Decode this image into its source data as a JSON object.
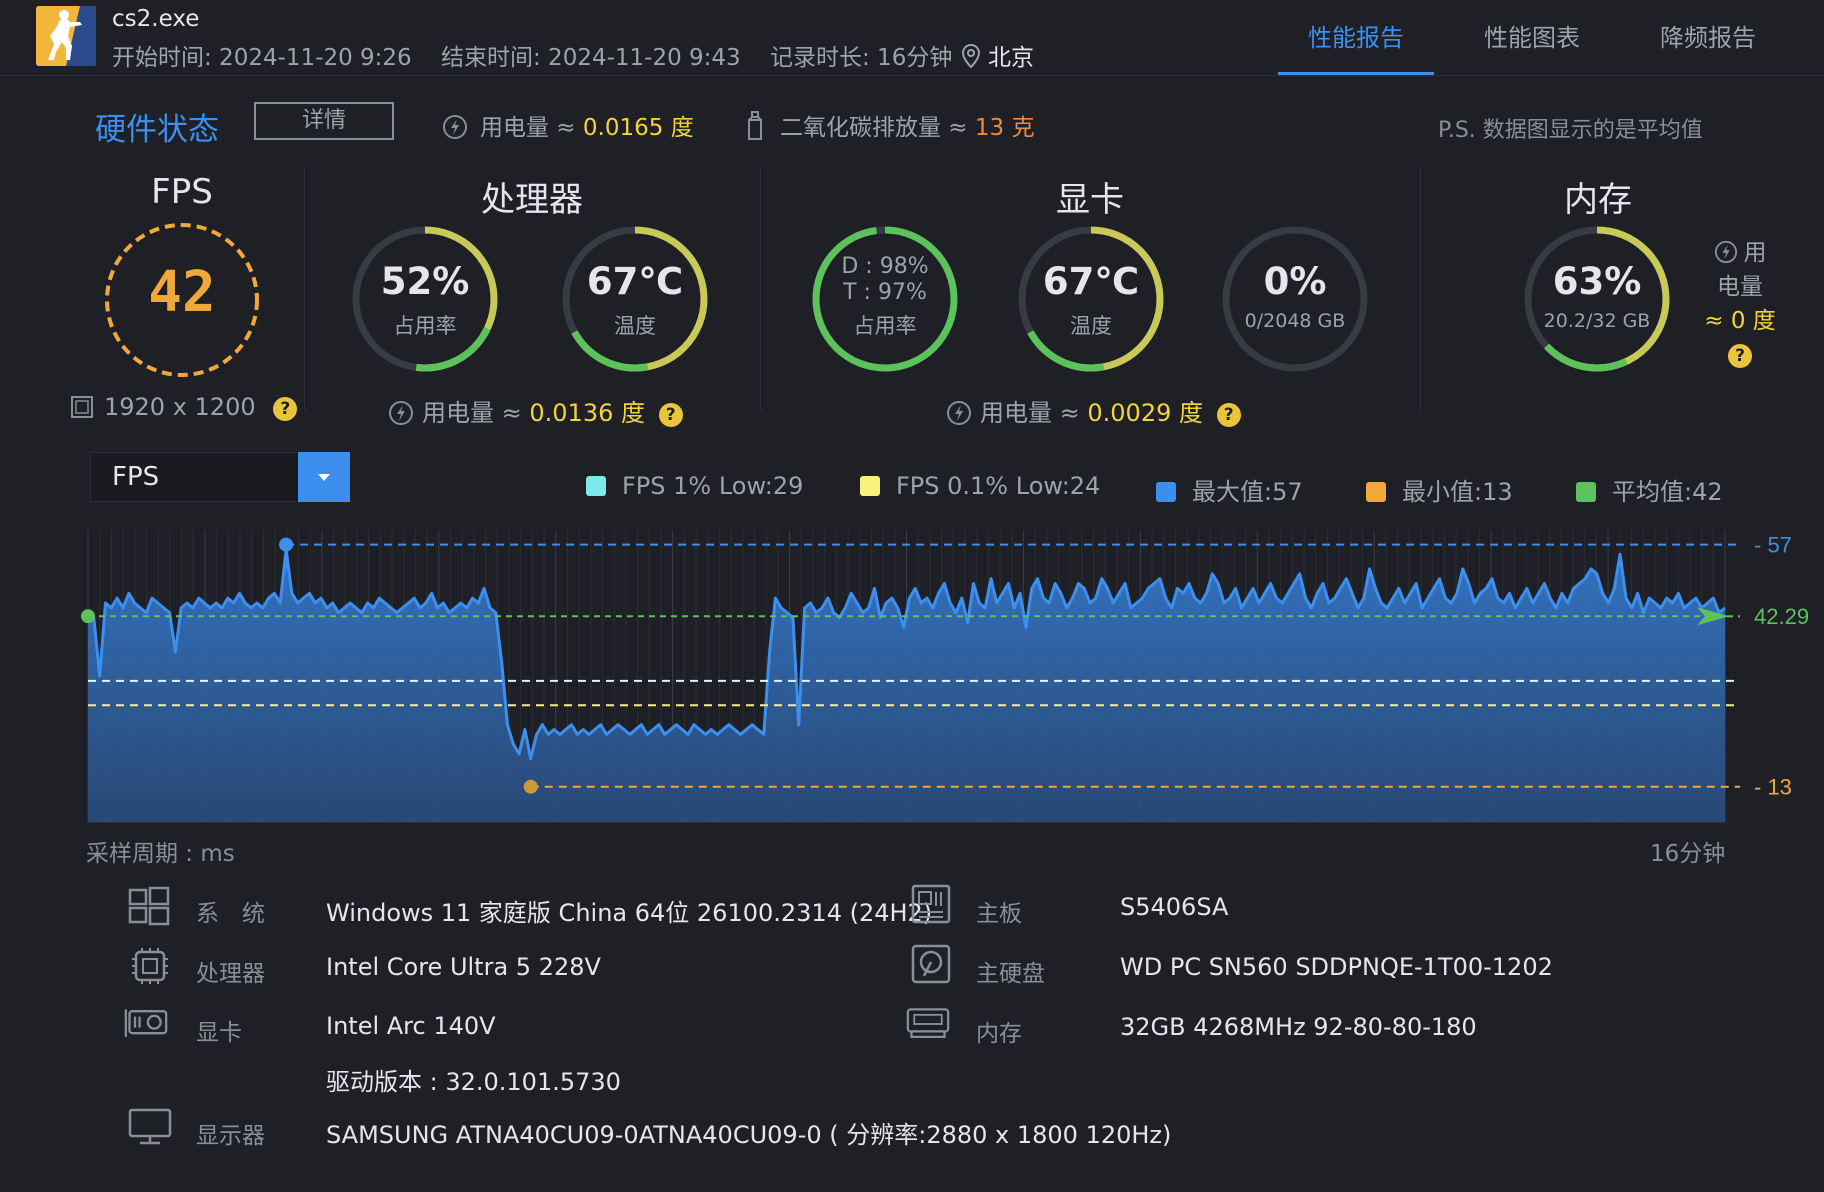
{
  "header": {
    "app_name": "cs2.exe",
    "start_time": "开始时间: 2024-11-20 9:26",
    "end_time": "结束时间: 2024-11-20 9:43",
    "duration": "记录时长: 16分钟",
    "location": "北京",
    "tabs": [
      "性能报告",
      "性能图表",
      "降频报告"
    ],
    "active_tab": "性能报告"
  },
  "hardware": {
    "title": "硬件状态",
    "details_label": "详情",
    "energy_label": "用电量 ≈ ",
    "energy_value": "0.0165 度",
    "co2_label": "二氧化碳排放量 ≈ ",
    "co2_value": "13 克",
    "note": "P.S. 数据图显示的是平均值"
  },
  "fps": {
    "title": "FPS",
    "value": "42",
    "resolution": "1920 x 1200"
  },
  "cpu": {
    "title": "处理器",
    "usage_value": "52%",
    "usage_label": "占用率",
    "usage_fraction": 0.52,
    "temp_value": "67℃",
    "temp_label": "温度",
    "temp_fraction": 0.67,
    "energy_label": "用电量 ≈ ",
    "energy_value": "0.0136 度"
  },
  "gpu": {
    "title": "显卡",
    "usage_d": "D : 98%",
    "usage_t": "T : 97%",
    "usage_label": "占用率",
    "usage_fraction": 0.98,
    "temp_value": "67℃",
    "temp_label": "温度",
    "temp_fraction": 0.67,
    "vram_value": "0%",
    "vram_label": "0/2048 GB",
    "vram_fraction": 0,
    "energy_label": "用电量 ≈ ",
    "energy_value": "0.0029 度"
  },
  "memory": {
    "title": "内存",
    "usage_value": "63%",
    "usage_label": "20.2/32 GB",
    "usage_fraction": 0.63,
    "energy_line1": "用",
    "energy_line2": "电量",
    "energy_line3": "≈ 0 度"
  },
  "chart_controls": {
    "selected_metric": "FPS",
    "legend": [
      {
        "label": "FPS 1% Low:29",
        "color": "#7ee8e8"
      },
      {
        "label": "FPS 0.1% Low:24",
        "color": "#f7f27a"
      },
      {
        "label": "最大值:57",
        "color": "#3d8fef"
      },
      {
        "label": "最小值:13",
        "color": "#f0a83a"
      },
      {
        "label": "平均值:42",
        "color": "#5cc25c"
      }
    ],
    "sample_period": "采样周期 : ms",
    "duration": "16分钟"
  },
  "chart_data": {
    "type": "area",
    "title": "",
    "xlabel": "",
    "ylabel": "",
    "ylim": [
      0,
      60
    ],
    "max": 57,
    "min": 13,
    "avg": 42.29,
    "low_1pct": 29,
    "low_01pct": 24,
    "max_label": "57",
    "avg_label": "42.29",
    "min_label": "13",
    "series": [
      {
        "values": [
          42,
          42,
          30,
          45,
          44,
          46,
          44,
          47,
          45,
          44,
          43,
          46,
          45,
          44,
          43,
          35,
          44,
          45,
          44,
          46,
          45,
          44,
          45,
          44,
          46,
          45,
          47,
          45,
          44,
          45,
          44,
          46,
          47,
          45,
          56,
          47,
          45,
          46,
          47,
          45,
          46,
          44,
          45,
          43,
          44,
          45,
          44,
          43,
          45,
          44,
          46,
          45,
          44,
          43,
          44,
          45,
          46,
          44,
          45,
          47,
          44,
          45,
          43,
          44,
          45,
          44,
          46,
          45,
          48,
          44,
          43,
          33,
          20,
          16,
          14,
          19,
          13,
          18,
          20,
          18,
          19,
          18,
          19,
          20,
          18,
          19,
          18,
          19,
          20,
          18,
          19,
          20,
          19,
          18,
          19,
          20,
          18,
          19,
          20,
          18,
          19,
          20,
          19,
          18,
          20,
          19,
          18,
          19,
          18,
          19,
          20,
          19,
          18,
          19,
          20,
          19,
          18,
          35,
          46,
          44,
          43,
          42,
          20,
          44,
          45,
          43,
          44,
          46,
          43,
          42,
          44,
          47,
          45,
          43,
          44,
          48,
          42,
          45,
          46,
          44,
          40,
          46,
          48,
          45,
          46,
          44,
          47,
          49,
          45,
          43,
          46,
          41,
          49,
          45,
          44,
          50,
          45,
          47,
          49,
          44,
          47,
          40,
          48,
          50,
          46,
          45,
          49,
          47,
          44,
          46,
          49,
          48,
          45,
          46,
          50,
          48,
          45,
          47,
          49,
          44,
          45,
          46,
          48,
          49,
          50,
          46,
          44,
          48,
          47,
          49,
          46,
          45,
          47,
          51,
          49,
          45,
          46,
          48,
          44,
          46,
          48,
          45,
          47,
          49,
          46,
          45,
          47,
          49,
          51,
          46,
          44,
          47,
          49,
          45,
          46,
          48,
          50,
          47,
          44,
          46,
          52,
          48,
          45,
          44,
          46,
          48,
          45,
          47,
          49,
          44,
          46,
          48,
          50,
          46,
          45,
          47,
          52,
          49,
          45,
          47,
          48,
          50,
          46,
          45,
          47,
          44,
          46,
          48,
          45,
          47,
          49,
          46,
          44,
          47,
          45,
          48,
          49,
          50,
          52,
          51,
          47,
          45,
          48,
          55,
          46,
          44,
          47,
          43,
          46,
          45,
          44,
          46,
          45,
          47,
          44,
          45,
          46,
          44,
          45,
          46,
          43,
          44
        ]
      }
    ]
  },
  "specs": {
    "os_label": "系　统",
    "os_value": "Windows 11 家庭版 China 64位 26100.2314 (24H2)",
    "cpu_label": "处理器",
    "cpu_value": "Intel Core Ultra 5 228V",
    "gpu_label": "显卡",
    "gpu_value": "Intel Arc 140V",
    "driver_value": "驱动版本 : 32.0.101.5730",
    "display_label": "显示器",
    "display_value": "SAMSUNG ATNA40CU09-0ATNA40CU09-0 ( 分辨率:2880 x 1800 120Hz)",
    "board_label": "主板",
    "board_value": "S5406SA",
    "disk_label": "主硬盘",
    "disk_value": "WD PC SN560 SDDPNQE-1T00-1202",
    "ram_label": "内存",
    "ram_value": "32GB 4268MHz 92-80-80-180"
  }
}
